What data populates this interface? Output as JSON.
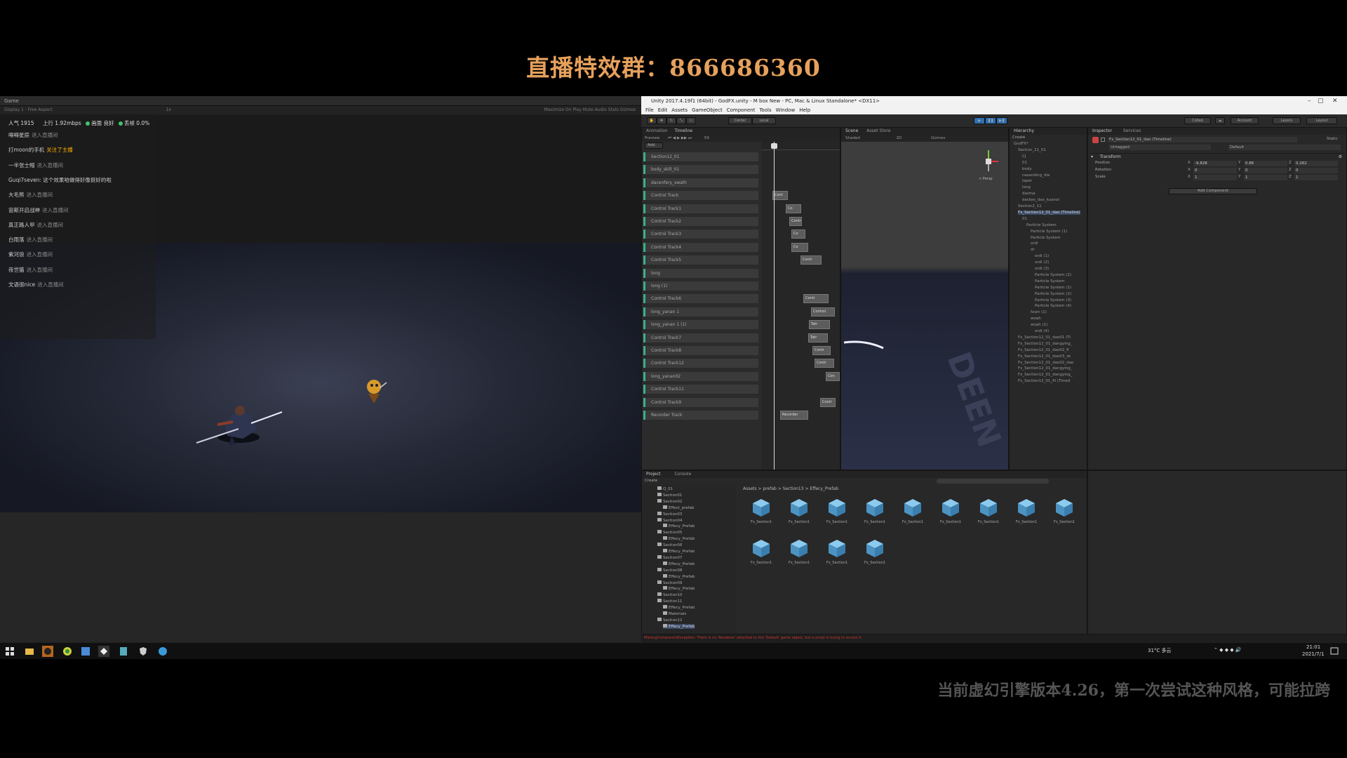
{
  "banner": {
    "title": "直播特效群：866686360"
  },
  "footer": {
    "note": "当前虚幻引擎版本4.26，第一次尝试这种风格，可能拉跨"
  },
  "game_window": {
    "tab": "Game",
    "toolbar_left": "Display 1  ·  Free Aspect",
    "toolbar_right": "Maximize On Play  Mute Audio  Stats  Gizmos",
    "scale": "1x"
  },
  "live": {
    "popularity": "人气 1915",
    "upload": "上行 1.92mbps",
    "quality": "画面 良好",
    "loss": "丢帧 0.0%",
    "messages": [
      {
        "user": "嘚嘚星辰",
        "action": "进入直播间",
        "highlight": ""
      },
      {
        "user": "打moon的手机",
        "action": "",
        "highlight": "关注了主播"
      },
      {
        "user": "一半张士帽",
        "action": "进入直播间",
        "highlight": ""
      },
      {
        "user": "Guqi7seven: 这个效果咱做得好像挺好的啦",
        "action": "",
        "highlight": ""
      },
      {
        "user": "大毛熊",
        "action": "进入直播间",
        "highlight": ""
      },
      {
        "user": "宙斯开启战神",
        "action": "进入直播间",
        "highlight": ""
      },
      {
        "user": "真正路人甲",
        "action": "进入直播间",
        "highlight": ""
      },
      {
        "user": "白雨落",
        "action": "进入直播间",
        "highlight": ""
      },
      {
        "user": "紫河浪",
        "action": "进入直播间",
        "highlight": ""
      },
      {
        "user": "夜世猫",
        "action": "进入直播间",
        "highlight": ""
      },
      {
        "user": "文语很nice",
        "action": "进入直播间",
        "highlight": ""
      }
    ]
  },
  "unity": {
    "title": "Unity 2017.4.19f1 (64bit) - GodFX.unity - M box New - PC, Mac & Linux Standalone* <DX11>",
    "menu": [
      "File",
      "Edit",
      "Assets",
      "GameObject",
      "Component",
      "Tools",
      "Window",
      "Help"
    ],
    "toolbar": {
      "center": "Center",
      "local": "Local",
      "collab": "Collab",
      "account": "Account",
      "layers": "Layers",
      "layout": "Layout"
    },
    "timeline": {
      "tabs": [
        "Animation",
        "Timeline"
      ],
      "preview": "Preview",
      "frame": "59",
      "add": "Add",
      "tracks": [
        "Section12_01",
        "body_skill_01",
        "dacenfery_swath",
        "Control Track",
        "Control Track1",
        "Control Track2",
        "Control Track3",
        "Control Track4",
        "Control Track5",
        "long",
        "long (1)",
        "Control Track6",
        "long_yanan 1",
        "long_yanan 1 (1)",
        "Control Track7",
        "Control Track8",
        "Control Track12",
        "long_yanan02",
        "Control Track11",
        "Control Track9",
        "Recorder Track"
      ],
      "clips": [
        "Cont",
        "Co",
        "Contr",
        "Co",
        "Co",
        "Contr",
        "Contr",
        "Control",
        "Tatr",
        "Tatr",
        "Contr",
        "Contr",
        "Con",
        "Contr",
        "Recorder"
      ]
    },
    "scene": {
      "tabs": [
        "Scene",
        "Asset Store"
      ],
      "shaded": "Shaded",
      "mode2d": "2D",
      "gizmos": "Gizmos",
      "persp": "< Persp",
      "watermark": "DEEN"
    },
    "hierarchy": {
      "tab": "Hierarchy",
      "create": "Create",
      "items": [
        "GodFX*",
        "Section_11_01",
        "CJ",
        "01",
        "body",
        "casanding_dia",
        "leper",
        "long",
        "dazma",
        "dackes_dax_kuanai",
        "Section2_11",
        "Fx_Section12_01_dao (Timeline)",
        "01",
        "Particle System",
        "Particle System (1)",
        "Particle System",
        "ordi",
        "dr",
        "ordi (1)",
        "ordi (2)",
        "ordi (3)",
        "Particle System (2)",
        "Particle System",
        "Particle System (1)",
        "Particle System (2)",
        "Particle System (3)",
        "Particle System (4)",
        "fxsm (1)",
        "woah",
        "woah (1)",
        "ordi (4)",
        "Fx_Section12_01_dao01 (Ti",
        "Fx_Section12_01_dangying_",
        "Fx_Section12_01_dao02_fi",
        "Fx_Section12_01_dao03_sk",
        "Fx_Section12_01_dao02_dao",
        "Fx_Section12_01_dangying_",
        "Fx_Section12_01_dangying_",
        "Fx_Section12_01_fil (Timeli"
      ]
    },
    "inspector": {
      "tabs": [
        "Inspector",
        "Services"
      ],
      "object": "Fx_Section12_01_dao (Timeline)",
      "static": "Static",
      "tag": "Untagged",
      "layer": "Default",
      "component": "Transform",
      "rows": [
        {
          "label": "Position",
          "x": "-9.828",
          "y": "0.86",
          "z": "0.262"
        },
        {
          "label": "Rotation",
          "x": "0",
          "y": "0",
          "z": "0"
        },
        {
          "label": "Scale",
          "x": "1",
          "y": "1",
          "z": "1"
        }
      ],
      "add_component": "Add Component"
    },
    "project": {
      "tabs": [
        "Project",
        "Console"
      ],
      "create": "Create",
      "breadcrumb": "Assets > prefab > Section13 > Effecy_Prefab",
      "tree": [
        "Q_01",
        "Section01",
        "Section02",
        "Effect_prefab",
        "Section03",
        "Section04",
        "Effecy_Prefab",
        "Section05",
        "Effecy_Prefab",
        "Section06",
        "Effecy_Prefab",
        "Section07",
        "Effecy_Prefab",
        "Section08",
        "Effecy_Prefab",
        "Section09",
        "Effecy_Prefab",
        "Section10",
        "Section11",
        "Effecy_Prefab",
        "Materials",
        "Section12",
        "Effecy_Prefab"
      ],
      "assets": [
        "Fx_Section1",
        "Fx_Section1",
        "Fx_Section1",
        "Fx_Section1",
        "Fx_Section1",
        "Fx_Section1",
        "Fx_Section1",
        "Fx_Section1",
        "Fx_Section1",
        "Fx_Section1",
        "Fx_Section1",
        "Fx_Section1",
        "Fx_Section1"
      ]
    },
    "status": "MissingComponentException: There is no 'Renderer' attached to the 'Default' game object, but a script is trying to access it."
  },
  "taskbar": {
    "weather": "31°C 多云",
    "time": "21:01",
    "date": "2021/7/1"
  },
  "colors": {
    "banner": "#e6a15c",
    "track_accent": "#3ab08a",
    "highlight": "#ffb000",
    "cube": "#5fa8d6"
  }
}
